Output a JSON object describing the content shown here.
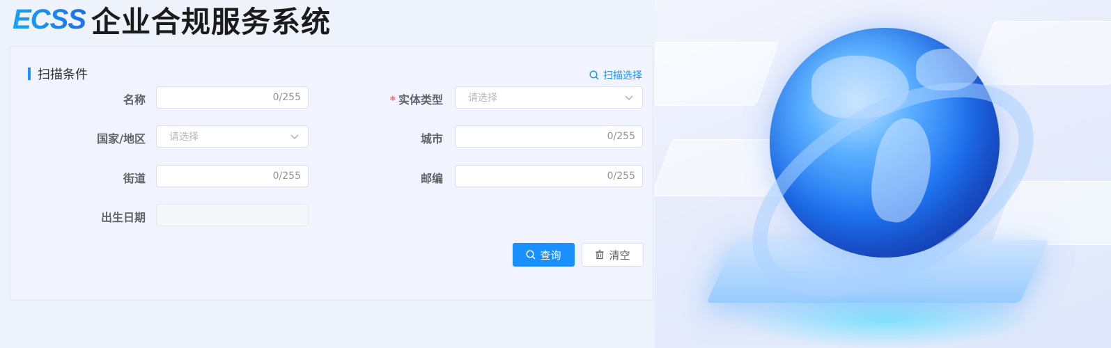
{
  "header": {
    "logo": "ECSS",
    "title": "企业合规服务系统"
  },
  "scan_panel": {
    "section_title": "扫描条件",
    "scan_select_label": "扫描选择",
    "fields": {
      "name": {
        "label": "名称",
        "counter": "0/255"
      },
      "entity_type": {
        "label": "实体类型",
        "required_mark": "*",
        "placeholder": "请选择"
      },
      "country_region": {
        "label": "国家/地区",
        "placeholder": "请选择"
      },
      "city": {
        "label": "城市",
        "counter": "0/255"
      },
      "street": {
        "label": "街道",
        "counter": "0/255"
      },
      "postcode": {
        "label": "邮编",
        "counter": "0/255"
      },
      "birth_date": {
        "label": "出生日期"
      }
    },
    "buttons": {
      "query": "查询",
      "clear": "清空"
    }
  },
  "colors": {
    "primary": "#1890ff",
    "required": "#f56c6c",
    "page_bg": "#eef2fb"
  }
}
